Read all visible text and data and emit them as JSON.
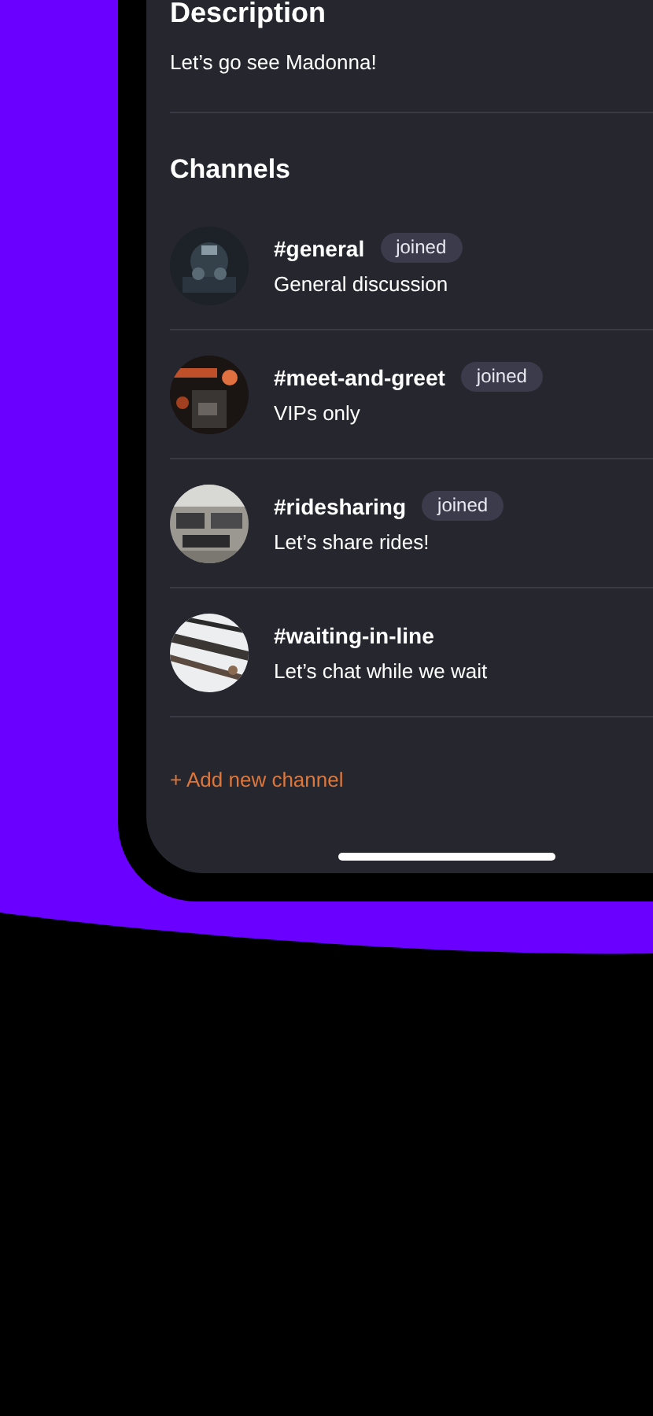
{
  "description": {
    "heading": "Description",
    "text": "Let’s go see Madonna!"
  },
  "channels": {
    "heading": "Channels",
    "items": [
      {
        "name": "#general",
        "badge": "joined",
        "subtitle": "General discussion"
      },
      {
        "name": "#meet-and-greet",
        "badge": "joined",
        "subtitle": "VIPs only"
      },
      {
        "name": "#ridesharing",
        "badge": "joined",
        "subtitle": "Let’s share rides!"
      },
      {
        "name": "#waiting-in-line",
        "subtitle": "Let’s chat while we wait"
      }
    ]
  },
  "add_channel": "+ Add new channel"
}
